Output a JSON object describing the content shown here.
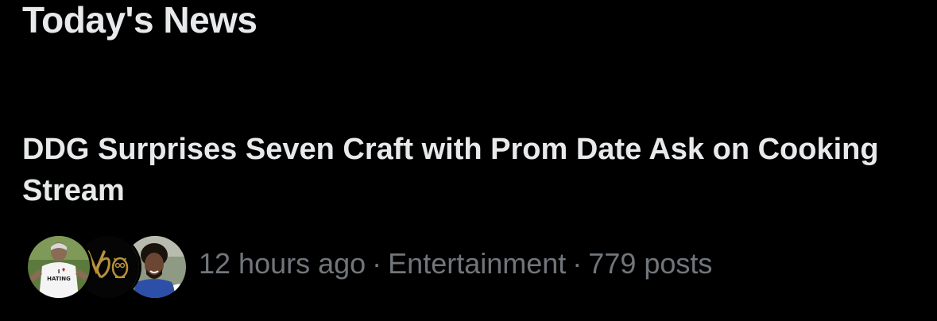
{
  "section": {
    "title": "Today's News"
  },
  "news_item": {
    "headline": "DDG Surprises Seven Craft with Prom Date Ask on Cooking Stream",
    "meta": {
      "time": "12 hours ago",
      "category": "Entertainment",
      "posts": "779 posts",
      "separator": "·"
    },
    "avatars": [
      {
        "name": "avatar-user-1"
      },
      {
        "name": "avatar-user-2"
      },
      {
        "name": "avatar-user-3"
      }
    ],
    "avatar_shirt_text": {
      "line1": "I",
      "line2": "HATING"
    }
  },
  "colors": {
    "background": "#000000",
    "primary_text": "#e7e9ea",
    "secondary_text": "#71767b",
    "logo_gold": "#b8923a",
    "jersey_blue": "#2d4fa8"
  }
}
